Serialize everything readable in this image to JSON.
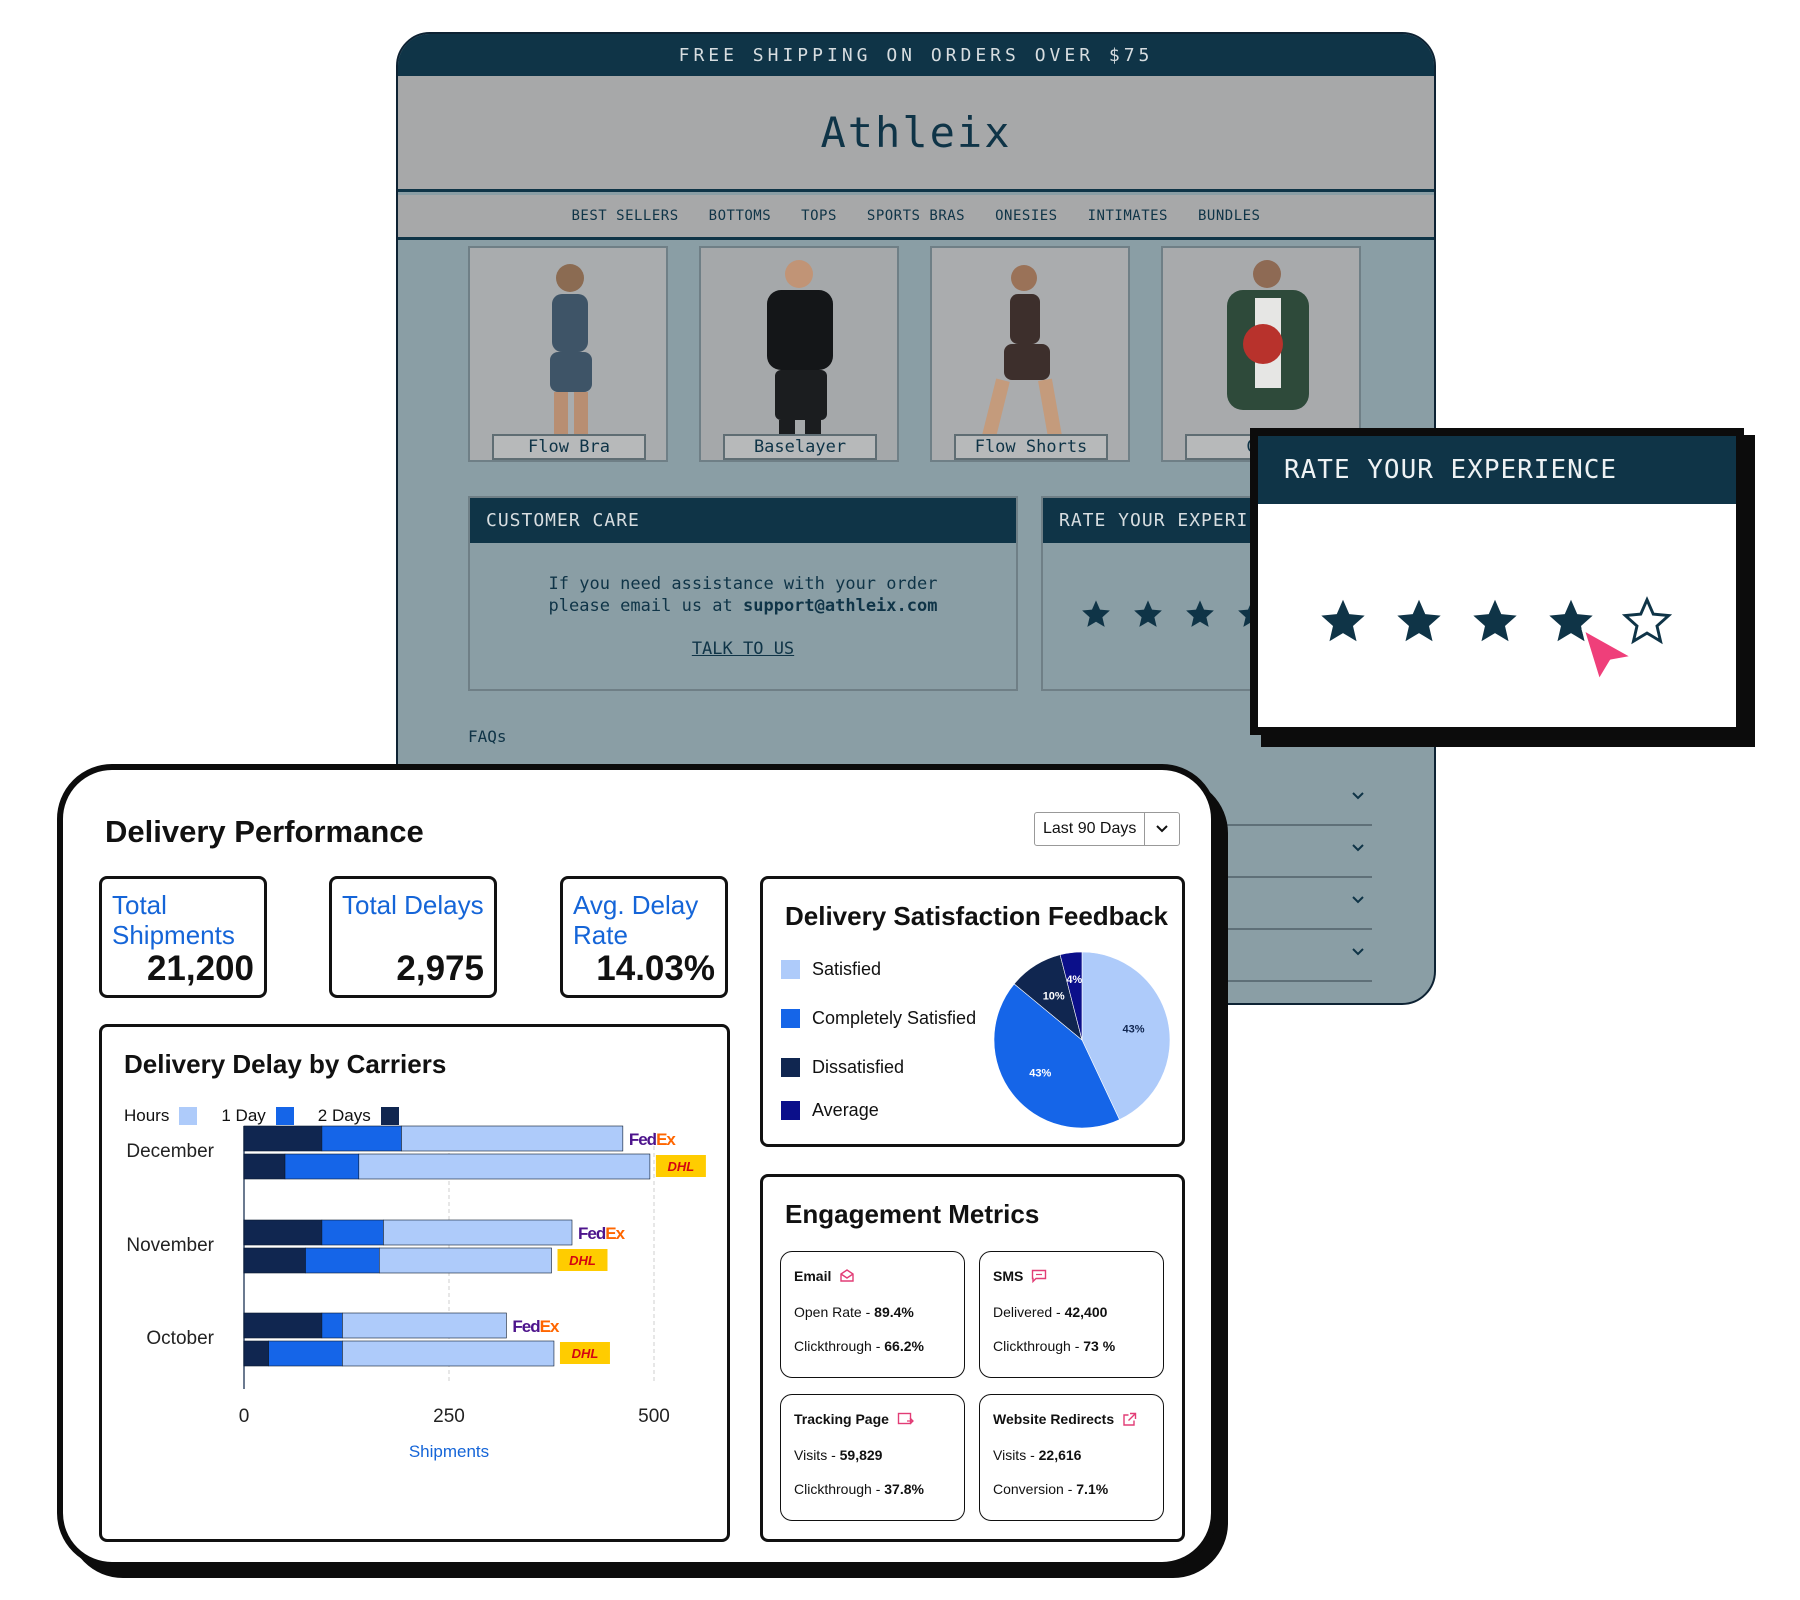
{
  "store": {
    "promo": "FREE SHIPPING ON ORDERS OVER $75",
    "brand": "Athleix",
    "nav": [
      "BEST SELLERS",
      "BOTTOMS",
      "TOPS",
      "SPORTS BRAS",
      "ONESIES",
      "INTIMATES",
      "BUNDLES"
    ],
    "products": [
      {
        "name": "Flow Bra"
      },
      {
        "name": "Baselayer"
      },
      {
        "name": "Flow Shorts"
      },
      {
        "name": "Gym"
      }
    ],
    "customer_care": {
      "title": "CUSTOMER CARE",
      "line1": "If you need assistance with your order",
      "line2_prefix": "please email us at ",
      "email": "support@athleix.com",
      "link": "TALK TO US"
    },
    "rate_panel_title": "RATE YOUR EXPERI",
    "faqs_label": "FAQs"
  },
  "rate_popup": {
    "title": "RATE YOUR EXPERIENCE",
    "rating": 4,
    "max": 5,
    "star_color": "#0f3447",
    "cursor_color": "#ef3f7a"
  },
  "dashboard": {
    "title": "Delivery Performance",
    "range": "Last 90 Days",
    "stats": [
      {
        "label": "Total Shipments",
        "value": "21,200"
      },
      {
        "label": "Total Delays",
        "value": "2,975"
      },
      {
        "label": "Avg. Delay Rate",
        "value": "14.03%"
      }
    ],
    "delay_card": {
      "title": "Delivery Delay by Carriers",
      "legend": [
        "Hours",
        "1 Day",
        "2 Days"
      ],
      "xlabel": "Shipments"
    },
    "satisfaction_card": {
      "title": "Delivery Satisfaction Feedback",
      "legend": [
        "Satisfied",
        "Completely Satisfied",
        "Dissatisfied",
        "Average"
      ]
    },
    "engagement": {
      "title": "Engagement Metrics",
      "cards": [
        {
          "title": "Email",
          "icon": "mail-icon",
          "l1": "Open Rate - ",
          "v1": "89.4%",
          "l2": "Clickthrough - ",
          "v2": "66.2%"
        },
        {
          "title": "SMS",
          "icon": "message-icon",
          "l1": "Delivered - ",
          "v1": "42,400",
          "l2": "Clickthrough - ",
          "v2": "73 %"
        },
        {
          "title": "Tracking Page",
          "icon": "tracking-icon",
          "l1": "Visits - ",
          "v1": "59,829",
          "l2": "Clickthrough - ",
          "v2": "37.8%"
        },
        {
          "title": "Website Redirects",
          "icon": "external-link-icon",
          "l1": "Visits - ",
          "v1": "22,616",
          "l2": "Conversion - ",
          "v2": "7.1%"
        }
      ]
    }
  },
  "colors": {
    "navy": "#0f3447",
    "hours": "#aecbfa",
    "one_day": "#1565e8",
    "two_days": "#102650",
    "average": "#0b0f8a",
    "accent_text": "#1565d8",
    "fedex_purple": "#4d148c",
    "fedex_orange": "#ff6600",
    "dhl_yellow": "#ffcc00",
    "dhl_red": "#d40511"
  },
  "chart_data": [
    {
      "type": "bar",
      "orientation": "horizontal",
      "stacked": true,
      "title": "Delivery Delay by Carriers",
      "xlabel": "Shipments",
      "xlim": [
        0,
        500
      ],
      "xticks": [
        0,
        250,
        500
      ],
      "categories": [
        "December",
        "November",
        "October"
      ],
      "carriers": [
        "FedEx",
        "DHL"
      ],
      "series": [
        {
          "name": "2 Days",
          "values": {
            "December": [
              95,
              50
            ],
            "November": [
              95,
              75
            ],
            "October": [
              95,
              30
            ]
          }
        },
        {
          "name": "1 Day",
          "values": {
            "December": [
              97,
              90
            ],
            "November": [
              75,
              90
            ],
            "October": [
              25,
              90
            ]
          }
        },
        {
          "name": "Hours",
          "values": {
            "December": [
              270,
              355
            ],
            "November": [
              230,
              210
            ],
            "October": [
              200,
              258
            ]
          }
        }
      ],
      "legend": "top-left"
    },
    {
      "type": "pie",
      "title": "Delivery Satisfaction Feedback",
      "slices": [
        {
          "name": "Satisfied",
          "value": 43,
          "label": "43%"
        },
        {
          "name": "Completely Satisfied",
          "value": 43,
          "label": "43%"
        },
        {
          "name": "Dissatisfied",
          "value": 10,
          "label": "10%"
        },
        {
          "name": "Average",
          "value": 4,
          "label": "4%"
        }
      ],
      "legend": "left"
    }
  ]
}
